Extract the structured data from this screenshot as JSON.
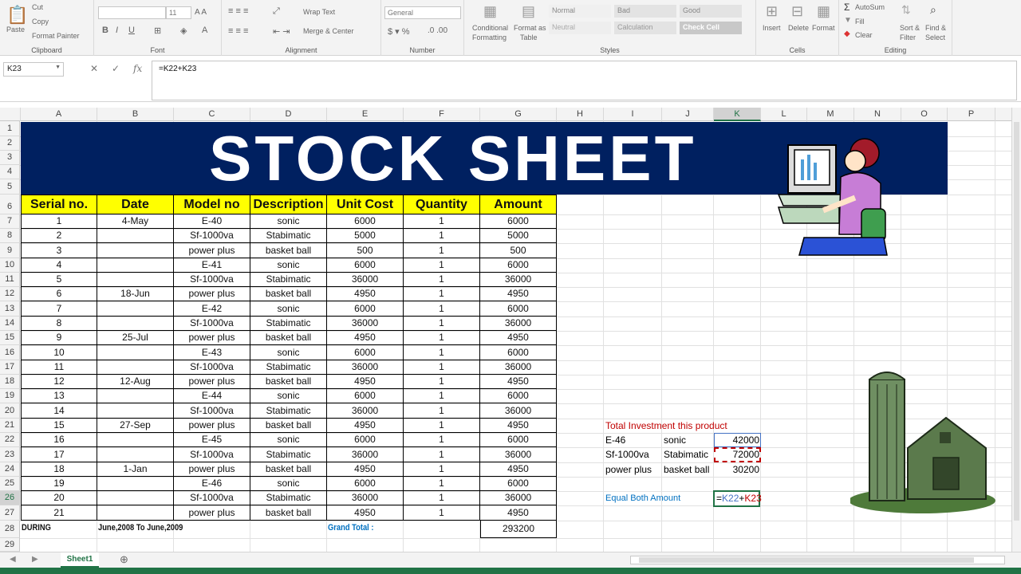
{
  "ribbon": {
    "clipboard": {
      "paste": "Paste",
      "cut": "Cut",
      "copy": "Copy",
      "format_painter": "Format Painter",
      "group": "Clipboard"
    },
    "font": {
      "size": "11",
      "group": "Font"
    },
    "alignment": {
      "wrap_text": "Wrap Text",
      "merge_center": "Merge & Center",
      "group": "Alignment"
    },
    "number": {
      "format": "General",
      "group": "Number"
    },
    "styles": {
      "conditional": "Conditional",
      "formatting": "Formatting",
      "format_as": "Format as",
      "table": "Table",
      "normal": "Normal",
      "bad": "Bad",
      "good": "Good",
      "neutral": "Neutral",
      "calculation": "Calculation",
      "check_cell": "Check Cell",
      "group": "Styles"
    },
    "cells": {
      "insert": "Insert",
      "delete": "Delete",
      "format": "Format",
      "group": "Cells"
    },
    "editing": {
      "autosum": "AutoSum",
      "fill": "Fill",
      "clear": "Clear",
      "sort": "Sort &",
      "filter": "Filter",
      "find": "Find &",
      "select": "Select",
      "group": "Editing"
    }
  },
  "formula_bar": {
    "name_box": "K23",
    "formula": "=K22+K23"
  },
  "columns": [
    "A",
    "B",
    "C",
    "D",
    "E",
    "F",
    "G",
    "H",
    "I",
    "J",
    "K",
    "L",
    "M",
    "N",
    "O",
    "P"
  ],
  "active_column": "K",
  "rows": [
    "1",
    "2",
    "3",
    "4",
    "5",
    "6",
    "7",
    "8",
    "9",
    "10",
    "11",
    "12",
    "13",
    "14",
    "15",
    "16",
    "17",
    "18",
    "19",
    "20",
    "21",
    "22",
    "23",
    "24",
    "25",
    "26",
    "27",
    "28",
    "29"
  ],
  "active_row": "26",
  "banner_title": "STOCK SHEET",
  "table": {
    "headers": [
      "Serial no.",
      "Date",
      "Model no",
      "Description",
      "Unit Cost",
      "Quantity",
      "Amount"
    ],
    "rows": [
      [
        "1",
        "4-May",
        "E-40",
        "sonic",
        "6000",
        "1",
        "6000"
      ],
      [
        "2",
        "",
        "Sf-1000va",
        "Stabimatic",
        "5000",
        "1",
        "5000"
      ],
      [
        "3",
        "",
        "power plus",
        "basket ball",
        "500",
        "1",
        "500"
      ],
      [
        "4",
        "",
        "E-41",
        "sonic",
        "6000",
        "1",
        "6000"
      ],
      [
        "5",
        "",
        "Sf-1000va",
        "Stabimatic",
        "36000",
        "1",
        "36000"
      ],
      [
        "6",
        "18-Jun",
        "power plus",
        "basket ball",
        "4950",
        "1",
        "4950"
      ],
      [
        "7",
        "",
        "E-42",
        "sonic",
        "6000",
        "1",
        "6000"
      ],
      [
        "8",
        "",
        "Sf-1000va",
        "Stabimatic",
        "36000",
        "1",
        "36000"
      ],
      [
        "9",
        "25-Jul",
        "power plus",
        "basket ball",
        "4950",
        "1",
        "4950"
      ],
      [
        "10",
        "",
        "E-43",
        "sonic",
        "6000",
        "1",
        "6000"
      ],
      [
        "11",
        "",
        "Sf-1000va",
        "Stabimatic",
        "36000",
        "1",
        "36000"
      ],
      [
        "12",
        "12-Aug",
        "power plus",
        "basket ball",
        "4950",
        "1",
        "4950"
      ],
      [
        "13",
        "",
        "E-44",
        "sonic",
        "6000",
        "1",
        "6000"
      ],
      [
        "14",
        "",
        "Sf-1000va",
        "Stabimatic",
        "36000",
        "1",
        "36000"
      ],
      [
        "15",
        "27-Sep",
        "power plus",
        "basket ball",
        "4950",
        "1",
        "4950"
      ],
      [
        "16",
        "",
        "E-45",
        "sonic",
        "6000",
        "1",
        "6000"
      ],
      [
        "17",
        "",
        "Sf-1000va",
        "Stabimatic",
        "36000",
        "1",
        "36000"
      ],
      [
        "18",
        "1-Jan",
        "power plus",
        "basket ball",
        "4950",
        "1",
        "4950"
      ],
      [
        "19",
        "",
        "E-46",
        "sonic",
        "6000",
        "1",
        "6000"
      ],
      [
        "20",
        "",
        "Sf-1000va",
        "Stabimatic",
        "36000",
        "1",
        "36000"
      ],
      [
        "21",
        "",
        "power plus",
        "basket ball",
        "4950",
        "1",
        "4950"
      ]
    ],
    "footer": {
      "during": "DURING",
      "period": "June,2008 To June,2009",
      "grand_total_label": "Grand Total :",
      "grand_total": "293200"
    }
  },
  "investment": {
    "title": "Total Investment this product",
    "rows": [
      [
        "E-46",
        "sonic",
        "42000"
      ],
      [
        "Sf-1000va",
        "Stabimatic",
        "72000"
      ],
      [
        "power plus",
        "basket ball",
        "30200"
      ]
    ],
    "equal_label": "Equal Both Amount",
    "formula_parts": [
      "=",
      "K22",
      "+",
      "K23"
    ],
    "colors": {
      "title": "#c00000",
      "label": "#0070c0",
      "ref1": "#4472c4",
      "ref2": "#c00000"
    }
  },
  "sheet_tab": "Sheet1"
}
